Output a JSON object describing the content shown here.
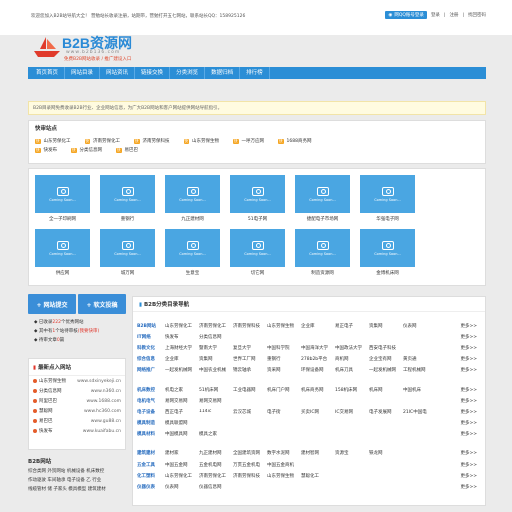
{
  "topbar": {
    "msg": "欢迎您加入B2B站导航大全！ 营勉站长收录注册，站期带，营勉打开五七网站，联系站长QQ：158925126",
    "qq": "网QQ账号登录",
    "register": "登录",
    "login": "注册",
    "find": "找回密码"
  },
  "logo": {
    "name": "B2B资源网",
    "url": "www.b2b136.com",
    "slogan": "免费B2B网站收录 / 推广建设入口"
  },
  "nav": [
    "首页首页",
    "网站目录",
    "网站资讯",
    "链接交换",
    "分类浏览",
    "数据归档",
    "排行榜"
  ],
  "notice": "B2B目录网免费收录B2B行业、企业网站信息，为广大B2B网站和客户网站提供网站导航指引。",
  "quick": {
    "title": "快审站点",
    "rows": [
      [
        "山东劳保化工",
        "济南劳保化工",
        "济南劳保科技",
        "山东劳保生物",
        "一呼万应网",
        "1688商务网"
      ],
      [
        "快发布",
        "分类信息网",
        "易巴巴"
      ]
    ]
  },
  "cards": [
    "全一子印刷网",
    "重钢行",
    "九正建材网",
    "51电子网",
    "捷配电子市场网",
    "华强电子网",
    "",
    "供应网",
    "城万网",
    "生意宝",
    "切它网",
    "制造资源网",
    "金博机床网",
    ""
  ],
  "card_placeholder": "Coming Soon...",
  "buttons": {
    "submit": "+ 网站提交",
    "article": "+ 软文投稿"
  },
  "stats": {
    "l1a": "已收录",
    "l1b": "222",
    "l1c": "个优秀网站",
    "l2a": "其中有",
    "l2b": "1",
    "l2c": "个站待审核",
    "l2d": "(我要快审)",
    "l3a": "待审文章",
    "l3b": "0",
    "l3c": "篇"
  },
  "recent": {
    "title": "最新点入网站",
    "items": [
      [
        "山东劳保生物",
        "www.sdxinyekeji.cn"
      ],
      [
        "分类信息网",
        "www.n360.cn"
      ],
      [
        "阿里巴巴",
        "www.1688.com"
      ],
      [
        "慧聪网",
        "www.hc360.com"
      ],
      [
        "易巴巴",
        "www.gu88.cn"
      ],
      [
        "快发布",
        "www.kuaifabu.cn"
      ]
    ]
  },
  "b2b": {
    "title": "B2B网站",
    "rows": [
      "综合类网 外贸网站 机械设备 机床数控",
      "作动驱驶 车间轴承 电子设备 乙 行业",
      "线缆管材 储 子家头 模具模型 建筑建材"
    ]
  },
  "catbox": {
    "title": "B2B分类目录导航",
    "more": "更多>>",
    "groups": [
      [
        [
          "B2B网站",
          [
            "山东劳保化工",
            "济南劳保化工",
            "济南劳保科技",
            "山东劳保生物",
            "企业库",
            "易正电子",
            "资集网",
            "仪表网"
          ]
        ],
        [
          "IT网络",
          [
            "快发布",
            "分类信息网"
          ]
        ],
        [
          "科教文化",
          [
            "上海财经大学",
            "暨南大学",
            "复旦大学",
            "中国科学院",
            "中国海洋大学",
            "中国政法大学",
            "西安电子科技"
          ]
        ],
        [
          "综合信息",
          [
            "企业库",
            "资集网",
            "世界工厂网",
            "重钢行",
            "278b2b平台",
            "商机网",
            "企业宝有网",
            "黄页通"
          ]
        ],
        [
          "网络推广",
          [
            "一起发机械网",
            "中国农业机械",
            "锦云轴承",
            "资采网",
            "环保设备网",
            "机床刀具",
            "一起发机械网",
            "工程机械网"
          ]
        ]
      ],
      [
        [
          "机床数控",
          [
            "机电之家",
            "51机床网",
            "工业电器网",
            "机床门户网",
            "机床商务网",
            "158机床网",
            "机床网",
            "中国机床"
          ]
        ],
        [
          "电机电气",
          [
            "易网交易网",
            "易网交易网"
          ]
        ],
        [
          "电子设备",
          [
            "西正电子",
            "114ic",
            "云汉芯城",
            "电子街",
            "买卖IC网",
            "IC交易网",
            "电子发展网",
            "21IC中国电"
          ]
        ],
        [
          "模具制造",
          [
            "模具联盟网"
          ]
        ],
        [
          "模具材料",
          [
            "中国模具网",
            "模具之家"
          ]
        ]
      ],
      [
        [
          "建筑建材",
          [
            "建材家",
            "九正建材网",
            "全国建筑资网",
            "数字水泥网",
            "建材智网",
            "资源宝",
            "铁龙网"
          ]
        ],
        [
          "五金工具",
          [
            "中国五金网",
            "五金机电网",
            "万贯五金机电",
            "中国五金商机"
          ]
        ],
        [
          "化工塑料",
          [
            "山东劳保化工",
            "济南劳保化工",
            "济南劳保科技",
            "山东劳保生物",
            "慧聪化工"
          ]
        ],
        [
          "仪器仪表",
          [
            "仪表网",
            "仪器信息网"
          ]
        ]
      ]
    ]
  }
}
